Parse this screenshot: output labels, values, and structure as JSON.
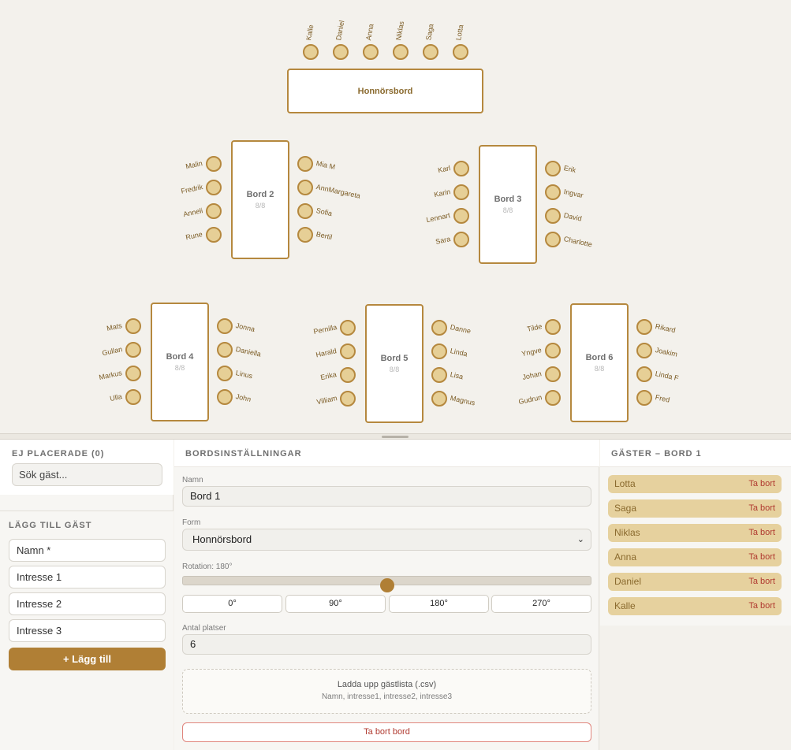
{
  "floor": {
    "honor_table": {
      "name": "Honnörsbord",
      "seats": [
        "Kalle",
        "Daniel",
        "Anna",
        "Niklas",
        "Saga",
        "Lotta"
      ]
    },
    "tables": [
      {
        "name": "Bord 2",
        "count": "8/8",
        "left": [
          "Malin",
          "Fredrik",
          "Anneli",
          "Rune"
        ],
        "right": [
          "Mia M",
          "AnnMargareta",
          "Sofia",
          "Bertil"
        ]
      },
      {
        "name": "Bord 3",
        "count": "8/8",
        "left": [
          "Karl",
          "Karin",
          "Lennart",
          "Sara"
        ],
        "right": [
          "Erik",
          "Ingvar",
          "David",
          "Charlotte"
        ]
      },
      {
        "name": "Bord 4",
        "count": "8/8",
        "left": [
          "Mats",
          "Gullan",
          "Markus",
          "Ulla"
        ],
        "right": [
          "Jonna",
          "Daniella",
          "Linus",
          "John"
        ]
      },
      {
        "name": "Bord 5",
        "count": "8/8",
        "left": [
          "Pernilla",
          "Harald",
          "Erika",
          "Villiam"
        ],
        "right": [
          "Danne",
          "Linda",
          "Lisa",
          "Magnus"
        ]
      },
      {
        "name": "Bord 6",
        "count": "8/8",
        "left": [
          "Tilde",
          "Yngve",
          "Johan",
          "Gudrun"
        ],
        "right": [
          "Rikard",
          "Joakim",
          "Linda F",
          "Fred"
        ]
      }
    ]
  },
  "unplaced": {
    "title": "EJ PLACERADE (0)",
    "search_placeholder": "Sök gäst..."
  },
  "add_guest": {
    "title": "LÄGG TILL GÄST",
    "name_placeholder": "Namn *",
    "interest1_placeholder": "Intresse 1",
    "interest2_placeholder": "Intresse 2",
    "interest3_placeholder": "Intresse 3",
    "button": "+ Lägg till"
  },
  "settings": {
    "title": "BORDSINSTÄLLNINGAR",
    "name_label": "Namn",
    "name_value": "Bord 1",
    "form_label": "Form",
    "form_value": "Honnörsbord",
    "rotation_label": "Rotation: 180°",
    "rotation_value": 180,
    "rotation_max": 360,
    "rotation_buttons": [
      "0°",
      "90°",
      "180°",
      "270°"
    ],
    "seats_label": "Antal platser",
    "seats_value": "6",
    "upload_title": "Ladda upp gästlista (.csv)",
    "upload_hint": "Namn, intresse1, intresse2, intresse3",
    "delete_button": "Ta bort bord"
  },
  "guests_panel": {
    "title": "GÄSTER – BORD 1",
    "remove_label": "Ta bort",
    "guests": [
      "Lotta",
      "Saga",
      "Niklas",
      "Anna",
      "Daniel",
      "Kalle"
    ]
  },
  "colors": {
    "accent": "#b07f35",
    "seat": "#e6cf96",
    "chip": "#e6d19e",
    "danger": "#b03a30"
  }
}
